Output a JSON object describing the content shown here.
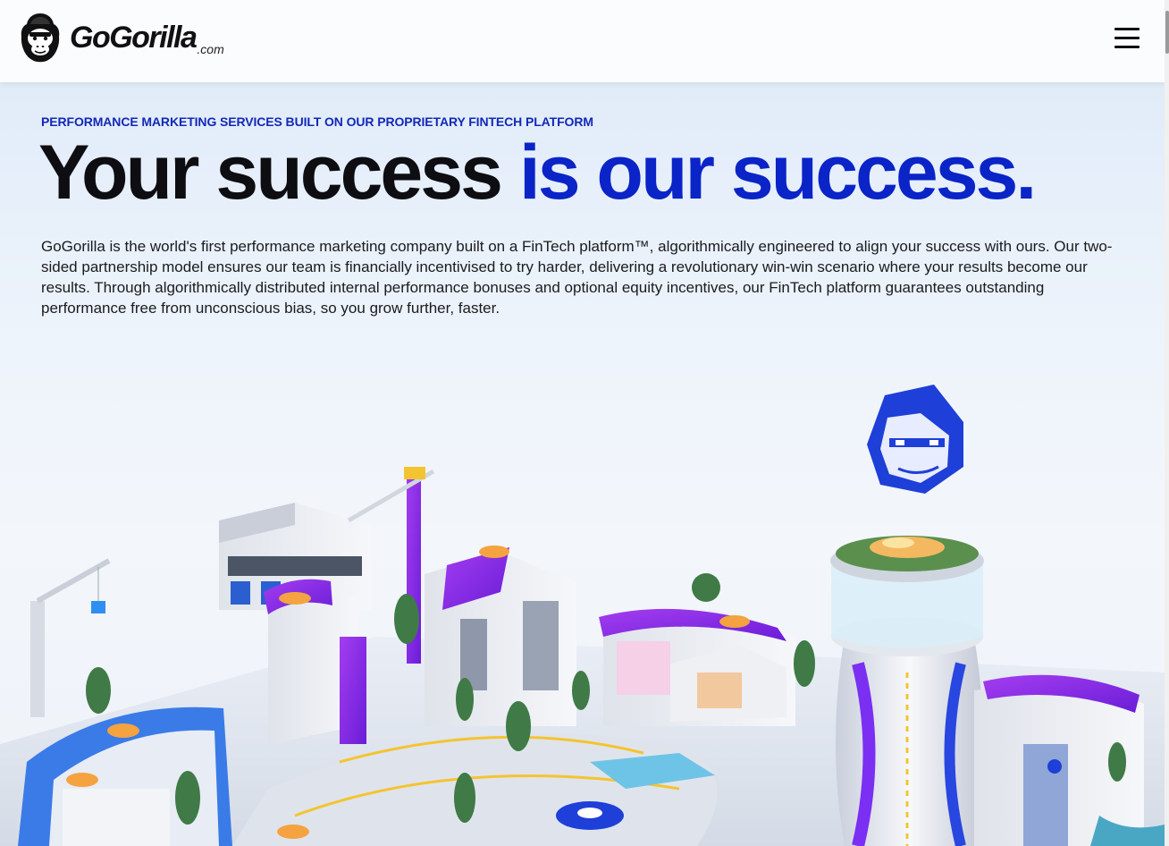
{
  "header": {
    "logo_text": "GoGorilla",
    "logo_suffix": ".com",
    "menu_icon": "hamburger-menu-icon"
  },
  "hero": {
    "eyebrow": "PERFORMANCE MARKETING SERVICES BUILT ON OUR PROPRIETARY FINTECH PLATFORM",
    "headline_dark": "Your success ",
    "headline_blue": "is our success.",
    "description": "GoGorilla is the world's first performance marketing company built on a FinTech platform™, algorithmically engineered to align your success with ours. Our two-sided partnership model ensures our team is financially incentivised to try harder, delivering a revolutionary win-win scenario where your results become our results. Through algorithmically distributed internal performance bonuses and optional equity incentives, our FinTech platform guarantees outstanding performance free from unconscious bias, so you grow further, faster.",
    "illustration_icon": "isometric-city-illustration"
  },
  "colors": {
    "accent_blue": "#0a24c8",
    "eyebrow_blue": "#1228b8",
    "purple": "#8a2be2",
    "text_dark": "#0d0d12"
  }
}
